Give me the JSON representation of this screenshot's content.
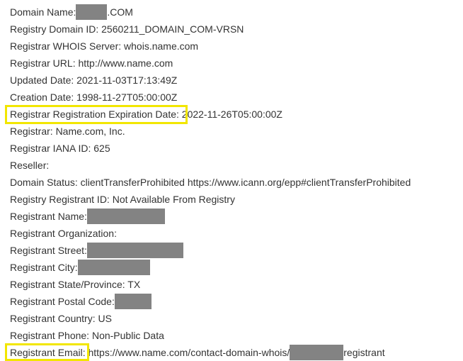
{
  "whois": {
    "domain_name": {
      "label": "Domain Name:",
      "suffix": ".COM"
    },
    "registry_domain_id": "Registry Domain ID: 2560211_DOMAIN_COM-VRSN",
    "registrar_whois_server": "Registrar WHOIS Server: whois.name.com",
    "registrar_url": "Registrar URL: http://www.name.com",
    "updated_date": "Updated Date: 2021-11-03T17:13:49Z",
    "creation_date": "Creation Date: 1998-11-27T05:00:00Z",
    "expiration": {
      "label": "Registrar Registration Expiration Date:",
      "value": " 2022-11-26T05:00:00Z"
    },
    "registrar": "Registrar: Name.com, Inc.",
    "registrar_iana_id": "Registrar IANA ID: 625",
    "reseller": "Reseller:",
    "domain_status": "Domain Status: clientTransferProhibited https://www.icann.org/epp#clientTransferProhibited",
    "registry_registrant_id": "Registry Registrant ID: Not Available From Registry",
    "registrant_name": "Registrant Name:",
    "registrant_organization": "Registrant Organization:",
    "registrant_street": "Registrant Street:",
    "registrant_city": "Registrant City:",
    "registrant_state": "Registrant State/Province: TX",
    "registrant_postal_code": "Registrant Postal Code:",
    "registrant_country": "Registrant Country: US",
    "registrant_phone": "Registrant Phone: Non-Public Data",
    "registrant_email": {
      "label": "Registrant Email:",
      "value_prefix": " https://www.name.com/contact-domain-whois/",
      "value_suffix": "registrant"
    }
  },
  "colors": {
    "text": "#333333",
    "redaction": "#838383",
    "highlight": "#f2e600"
  }
}
